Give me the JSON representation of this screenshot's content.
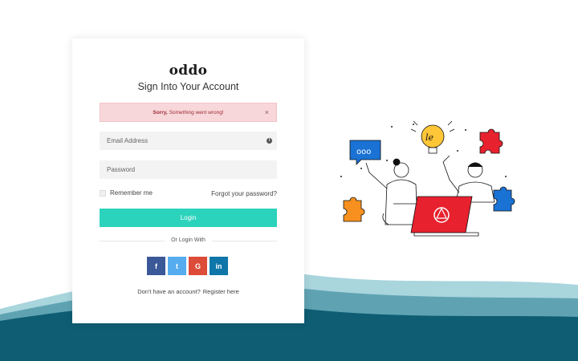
{
  "brand": {
    "logo_text": "oddo"
  },
  "form": {
    "title": "Sign Into Your Account",
    "alert": {
      "strong": "Sorry,",
      "message": "Something went wrong!",
      "close": "×"
    },
    "email_placeholder": "Email Address",
    "password_placeholder": "Password",
    "remember_label": "Remember me",
    "forgot_label": "Forgot your password?",
    "login_label": "Login",
    "or_label": "Or Login With",
    "socials": [
      {
        "name": "facebook",
        "glyph": "f",
        "color": "#3b5998"
      },
      {
        "name": "twitter",
        "glyph": "t",
        "color": "#55acee"
      },
      {
        "name": "google",
        "glyph": "G",
        "color": "#dd4b39"
      },
      {
        "name": "linkedin",
        "glyph": "in",
        "color": "#0e76a8"
      }
    ],
    "signup_prompt": "Don't have an account?",
    "signup_link": "Register here"
  },
  "colors": {
    "accent": "#2bd3bc",
    "wave_dark": "#0e5d73",
    "wave_light": "#8fc6d1",
    "alert_bg": "#f8d7da"
  },
  "illustration": {
    "bubble_text": "ooo",
    "bulb_text": "le"
  }
}
